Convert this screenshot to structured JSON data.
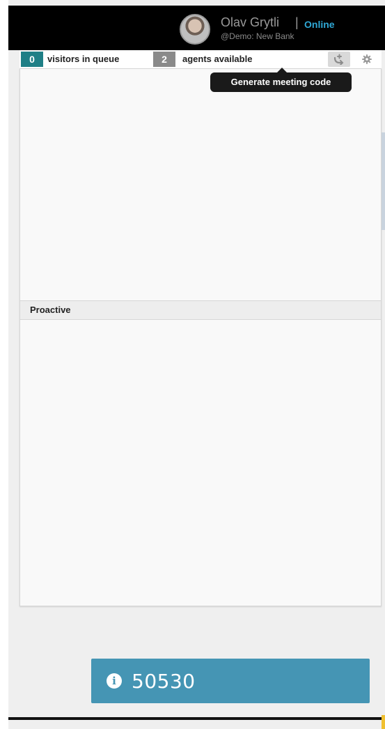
{
  "header": {
    "user_name": "Olav Grytli",
    "separator": "|",
    "status": "Online",
    "organization": "@Demo: New Bank"
  },
  "status_bar": {
    "visitors_in_queue_count": "0",
    "visitors_in_queue_label": "visitors in queue",
    "agents_available_count": "2",
    "agents_available_label": "agents available"
  },
  "tooltip": {
    "text": "Generate meeting code"
  },
  "sections": {
    "proactive_title": "Proactive"
  },
  "meeting_code": {
    "value": "50530"
  },
  "icons": {
    "meeting": "meeting-code-icon",
    "settings": "gear-icon",
    "info": "info-icon"
  },
  "colors": {
    "header_bg": "#000000",
    "status_online": "#2fa8d6",
    "queue_badge": "#1f7f86",
    "agents_badge": "#8a8a8a",
    "banner_bg": "#4595b4"
  }
}
